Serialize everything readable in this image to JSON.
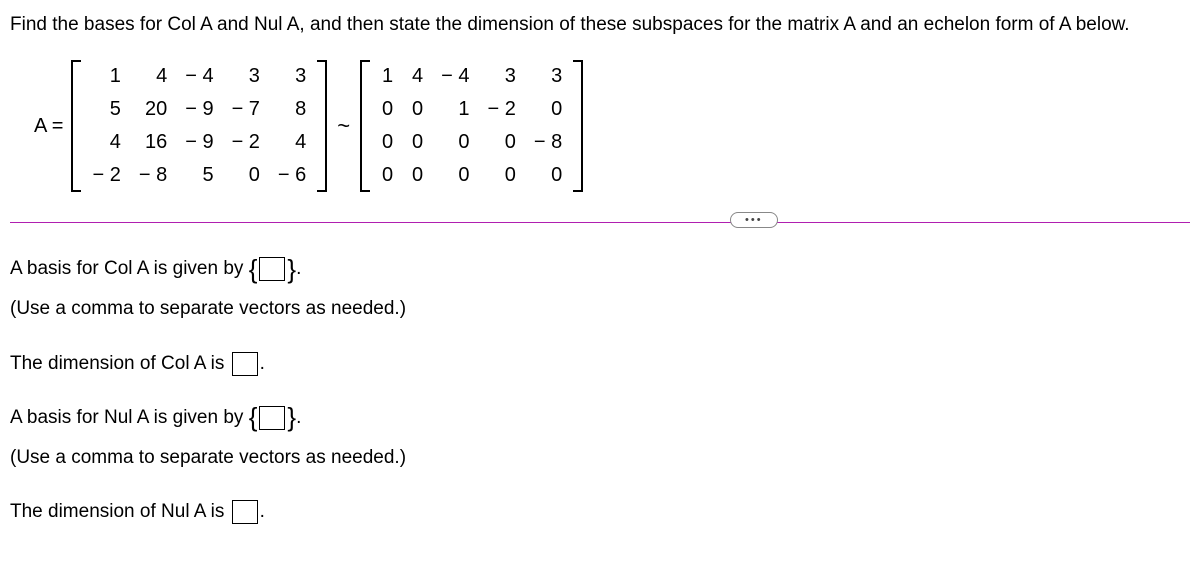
{
  "question": "Find the bases for Col A and Nul A, and then state the dimension of these subspaces for the matrix A and an echelon form of A below.",
  "matrix_label": "A =",
  "tilde": "~",
  "matrixA": [
    [
      "1",
      "4",
      "− 4",
      "3",
      "3"
    ],
    [
      "5",
      "20",
      "− 9",
      "− 7",
      "8"
    ],
    [
      "4",
      "16",
      "− 9",
      "− 2",
      "4"
    ],
    [
      "− 2",
      "− 8",
      "5",
      "0",
      "− 6"
    ]
  ],
  "matrixE": [
    [
      "1",
      "4",
      "− 4",
      "3",
      "3"
    ],
    [
      "0",
      "0",
      "1",
      "− 2",
      "0"
    ],
    [
      "0",
      "0",
      "0",
      "0",
      "− 8"
    ],
    [
      "0",
      "0",
      "0",
      "0",
      "0"
    ]
  ],
  "more_label": "•••",
  "answers": {
    "colA_basis_prefix": "A basis for Col A is given by ",
    "colA_basis_suffix": ".",
    "hint_vectors": "(Use a comma to separate vectors as needed.)",
    "colA_dim_prefix": "The dimension of Col A is ",
    "colA_dim_suffix": ".",
    "nulA_basis_prefix": "A basis for Nul A is given by ",
    "nulA_basis_suffix": ".",
    "nulA_dim_prefix": "The dimension of Nul A is ",
    "nulA_dim_suffix": "."
  }
}
